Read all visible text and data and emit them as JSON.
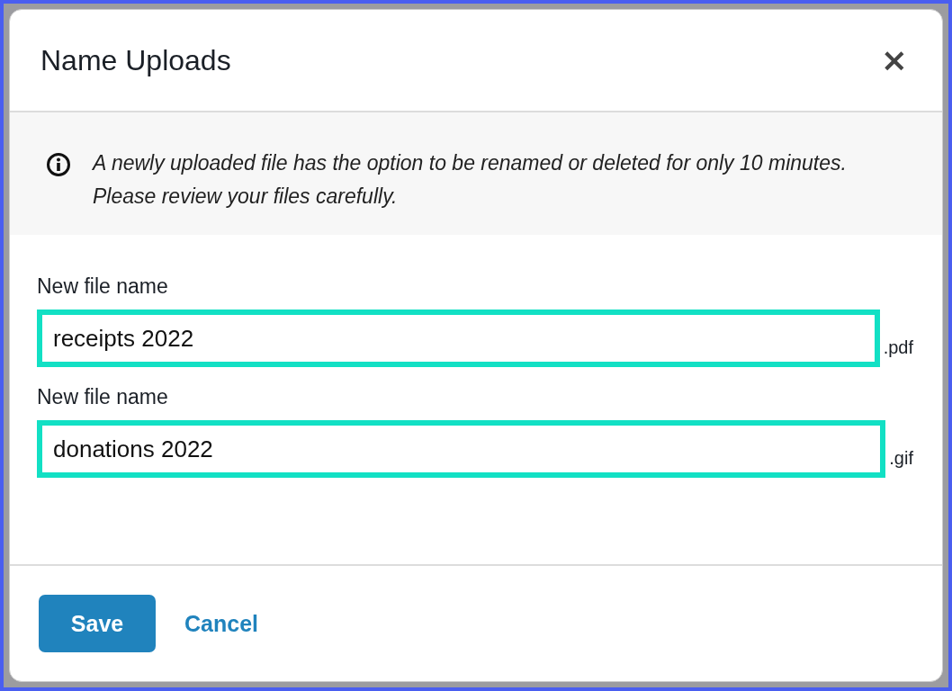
{
  "dialog": {
    "title": "Name Uploads",
    "close": "×"
  },
  "notice": {
    "text": "A newly uploaded file has the option to be renamed or deleted for only 10 minutes. Please review your files carefully."
  },
  "fields": [
    {
      "label": "New file name",
      "value": "receipts 2022",
      "suffix": ".pdf"
    },
    {
      "label": "New file name",
      "value": "donations 2022",
      "suffix": ".gif"
    }
  ],
  "buttons": {
    "save": "Save",
    "cancel": "Cancel"
  }
}
